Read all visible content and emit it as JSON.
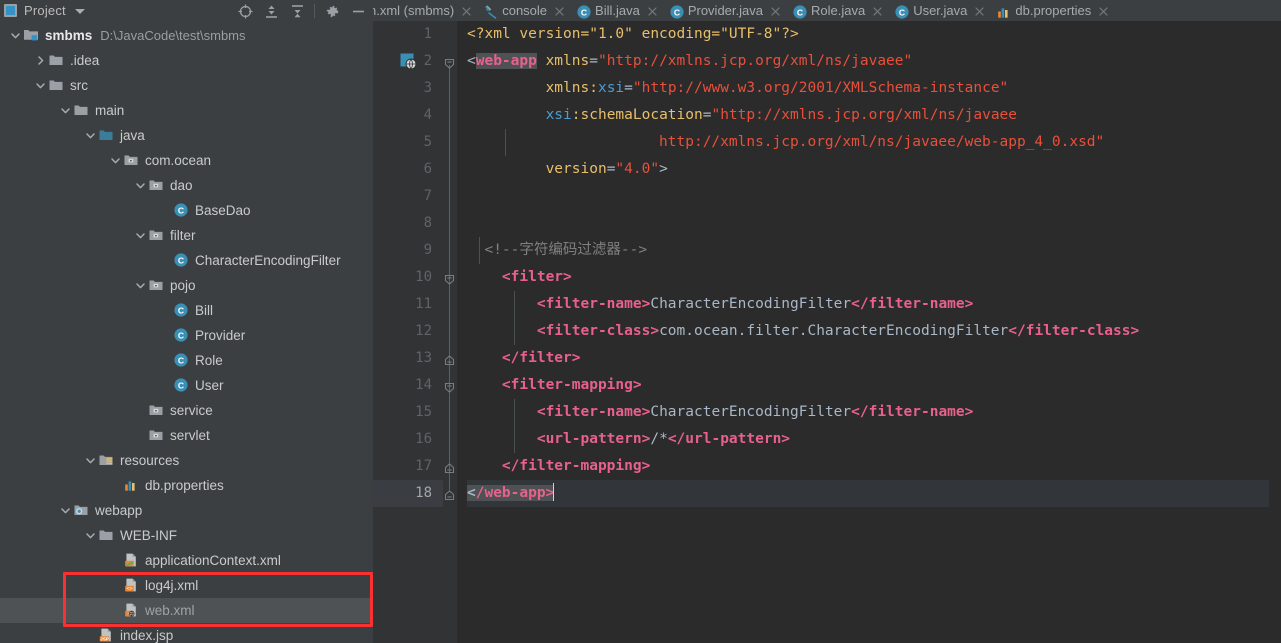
{
  "project_panel": {
    "title": "Project",
    "toolbar_icons": [
      {
        "name": "locate-icon",
        "glyph": "target"
      },
      {
        "name": "expand-all-icon",
        "glyph": "expand"
      },
      {
        "name": "collapse-all-icon",
        "glyph": "collapse"
      },
      {
        "name": "settings-gear-icon",
        "glyph": "gear"
      },
      {
        "name": "hide-panel-icon",
        "glyph": "minus"
      }
    ],
    "root": {
      "name": "smbms",
      "path": "D:\\JavaCode\\test\\smbms"
    },
    "tree": [
      {
        "label": "smbms",
        "detail": "D:\\JavaCode\\test\\smbms",
        "depth": 0,
        "icon": "module-folder",
        "arrow": "down",
        "bold": true,
        "selected": false
      },
      {
        "label": ".idea",
        "detail": "",
        "depth": 1,
        "icon": "folder",
        "arrow": "right",
        "bold": false,
        "selected": false
      },
      {
        "label": "src",
        "detail": "",
        "depth": 1,
        "icon": "folder",
        "arrow": "down",
        "bold": false,
        "selected": false
      },
      {
        "label": "main",
        "detail": "",
        "depth": 2,
        "icon": "folder",
        "arrow": "down",
        "bold": false,
        "selected": false
      },
      {
        "label": "java",
        "detail": "",
        "depth": 3,
        "icon": "source-folder",
        "arrow": "down",
        "bold": false,
        "selected": false
      },
      {
        "label": "com.ocean",
        "detail": "",
        "depth": 4,
        "icon": "package",
        "arrow": "down",
        "bold": false,
        "selected": false
      },
      {
        "label": "dao",
        "detail": "",
        "depth": 5,
        "icon": "package",
        "arrow": "down",
        "bold": false,
        "selected": false
      },
      {
        "label": "BaseDao",
        "detail": "",
        "depth": 6,
        "icon": "java-class",
        "arrow": "none",
        "bold": false,
        "selected": false
      },
      {
        "label": "filter",
        "detail": "",
        "depth": 5,
        "icon": "package",
        "arrow": "down",
        "bold": false,
        "selected": false
      },
      {
        "label": "CharacterEncodingFilter",
        "detail": "",
        "depth": 6,
        "icon": "java-class",
        "arrow": "none",
        "bold": false,
        "selected": false
      },
      {
        "label": "pojo",
        "detail": "",
        "depth": 5,
        "icon": "package",
        "arrow": "down",
        "bold": false,
        "selected": false
      },
      {
        "label": "Bill",
        "detail": "",
        "depth": 6,
        "icon": "java-class",
        "arrow": "none",
        "bold": false,
        "selected": false
      },
      {
        "label": "Provider",
        "detail": "",
        "depth": 6,
        "icon": "java-class",
        "arrow": "none",
        "bold": false,
        "selected": false
      },
      {
        "label": "Role",
        "detail": "",
        "depth": 6,
        "icon": "java-class",
        "arrow": "none",
        "bold": false,
        "selected": false
      },
      {
        "label": "User",
        "detail": "",
        "depth": 6,
        "icon": "java-class",
        "arrow": "none",
        "bold": false,
        "selected": false
      },
      {
        "label": "service",
        "detail": "",
        "depth": 5,
        "icon": "package",
        "arrow": "none",
        "bold": false,
        "selected": false
      },
      {
        "label": "servlet",
        "detail": "",
        "depth": 5,
        "icon": "package",
        "arrow": "none",
        "bold": false,
        "selected": false
      },
      {
        "label": "resources",
        "detail": "",
        "depth": 3,
        "icon": "resource-folder",
        "arrow": "down",
        "bold": false,
        "selected": false
      },
      {
        "label": "db.properties",
        "detail": "",
        "depth": 4,
        "icon": "properties-file",
        "arrow": "none",
        "bold": false,
        "selected": false
      },
      {
        "label": "webapp",
        "detail": "",
        "depth": 2,
        "icon": "web-folder",
        "arrow": "down",
        "bold": false,
        "selected": false
      },
      {
        "label": "WEB-INF",
        "detail": "",
        "depth": 3,
        "icon": "folder",
        "arrow": "down",
        "bold": false,
        "selected": false
      },
      {
        "label": "applicationContext.xml",
        "detail": "",
        "depth": 4,
        "icon": "spring-xml-file",
        "arrow": "none",
        "bold": false,
        "selected": false
      },
      {
        "label": "log4j.xml",
        "detail": "",
        "depth": 4,
        "icon": "xml-file",
        "arrow": "none",
        "bold": false,
        "selected": false
      },
      {
        "label": "web.xml",
        "detail": "",
        "depth": 4,
        "icon": "web-xml-file",
        "arrow": "none",
        "bold": false,
        "selected": true
      },
      {
        "label": "index.jsp",
        "detail": "",
        "depth": 3,
        "icon": "jsp-file",
        "arrow": "none",
        "bold": false,
        "selected": false
      }
    ],
    "annotation": {
      "color": "#f93131",
      "covers": [
        "log4j.xml",
        "web.xml"
      ]
    }
  },
  "editor": {
    "tabs": [
      {
        "label": "n.xml (smbms)",
        "icon": "xml-file",
        "active": false,
        "truncated": true,
        "closable": true
      },
      {
        "label": "console",
        "icon": "console-icon",
        "active": false,
        "truncated": false,
        "closable": true
      },
      {
        "label": "Bill.java",
        "icon": "java-class",
        "active": false,
        "truncated": false,
        "closable": true
      },
      {
        "label": "Provider.java",
        "icon": "java-class",
        "active": false,
        "truncated": false,
        "closable": true
      },
      {
        "label": "Role.java",
        "icon": "java-class",
        "active": false,
        "truncated": false,
        "closable": true
      },
      {
        "label": "User.java",
        "icon": "java-class",
        "active": false,
        "truncated": false,
        "closable": true
      },
      {
        "label": "db.properties",
        "icon": "properties-file",
        "active": false,
        "truncated": false,
        "closable": true
      }
    ],
    "filename": "web.xml",
    "current_line": 18,
    "total_lines": 18,
    "line_numbers": [
      "1",
      "2",
      "3",
      "4",
      "5",
      "6",
      "7",
      "8",
      "9",
      "10",
      "11",
      "12",
      "13",
      "14",
      "15",
      "16",
      "17",
      "18"
    ],
    "code_lines": [
      {
        "n": 1,
        "tokens": [
          {
            "t": "<?xml version=\"1.0\" encoding=\"UTF-8\"?>",
            "c": "proc"
          }
        ],
        "indent": 0
      },
      {
        "n": 2,
        "tokens": [
          {
            "t": "<",
            "c": "punct"
          },
          {
            "t": "web-app",
            "c": "tag-sel"
          },
          {
            "t": " ",
            "c": "text"
          },
          {
            "t": "xmlns",
            "c": "attrn"
          },
          {
            "t": "=",
            "c": "punct"
          },
          {
            "t": "\"http://xmlns.jcp.org/xml/ns/javaee\"",
            "c": "str"
          }
        ],
        "indent": 0
      },
      {
        "n": 3,
        "tokens": [
          {
            "t": "         ",
            "c": "text"
          },
          {
            "t": "xmlns:xsi",
            "c": "attrn-ns"
          },
          {
            "t": "=",
            "c": "punct"
          },
          {
            "t": "\"http://www.w3.org/2001/XMLSchema-instance\"",
            "c": "str"
          }
        ],
        "indent": 0
      },
      {
        "n": 4,
        "tokens": [
          {
            "t": "         ",
            "c": "text"
          },
          {
            "t": "xsi:schemaLocation",
            "c": "ns-attrn"
          },
          {
            "t": "=",
            "c": "punct"
          },
          {
            "t": "\"http://xmlns.jcp.org/xml/ns/javaee",
            "c": "str"
          }
        ],
        "indent": 0
      },
      {
        "n": 5,
        "tokens": [
          {
            "t": "                      http://xmlns.jcp.org/xml/ns/javaee/web-app_4_0.xsd\"",
            "c": "str"
          }
        ],
        "indent": 0
      },
      {
        "n": 6,
        "tokens": [
          {
            "t": "         ",
            "c": "text"
          },
          {
            "t": "version",
            "c": "attrn"
          },
          {
            "t": "=",
            "c": "punct"
          },
          {
            "t": "\"4.0\"",
            "c": "str"
          },
          {
            "t": ">",
            "c": "punct"
          }
        ],
        "indent": 0
      },
      {
        "n": 7,
        "tokens": [],
        "indent": 0
      },
      {
        "n": 8,
        "tokens": [],
        "indent": 0
      },
      {
        "n": 9,
        "tokens": [
          {
            "t": "  ",
            "c": "text"
          },
          {
            "t": "<!--字符编码过滤器-->",
            "c": "comment"
          }
        ],
        "indent": 0
      },
      {
        "n": 10,
        "tokens": [
          {
            "t": "    ",
            "c": "text"
          },
          {
            "t": "<filter>",
            "c": "tag"
          }
        ],
        "indent": 0
      },
      {
        "n": 11,
        "tokens": [
          {
            "t": "        ",
            "c": "text"
          },
          {
            "t": "<filter-name>",
            "c": "tag"
          },
          {
            "t": "CharacterEncodingFilter",
            "c": "text"
          },
          {
            "t": "</filter-name>",
            "c": "tag"
          }
        ],
        "indent": 0
      },
      {
        "n": 12,
        "tokens": [
          {
            "t": "        ",
            "c": "text"
          },
          {
            "t": "<filter-class>",
            "c": "tag"
          },
          {
            "t": "com.ocean.filter.CharacterEncodingFilter",
            "c": "text"
          },
          {
            "t": "</filter-class>",
            "c": "tag"
          }
        ],
        "indent": 0
      },
      {
        "n": 13,
        "tokens": [
          {
            "t": "    ",
            "c": "text"
          },
          {
            "t": "</filter>",
            "c": "tag"
          }
        ],
        "indent": 0
      },
      {
        "n": 14,
        "tokens": [
          {
            "t": "    ",
            "c": "text"
          },
          {
            "t": "<filter-mapping>",
            "c": "tag"
          }
        ],
        "indent": 0
      },
      {
        "n": 15,
        "tokens": [
          {
            "t": "        ",
            "c": "text"
          },
          {
            "t": "<filter-name>",
            "c": "tag"
          },
          {
            "t": "CharacterEncodingFilter",
            "c": "text"
          },
          {
            "t": "</filter-name>",
            "c": "tag"
          }
        ],
        "indent": 0
      },
      {
        "n": 16,
        "tokens": [
          {
            "t": "        ",
            "c": "text"
          },
          {
            "t": "<url-pattern>",
            "c": "tag"
          },
          {
            "t": "/*",
            "c": "text"
          },
          {
            "t": "</url-pattern>",
            "c": "tag"
          }
        ],
        "indent": 0
      },
      {
        "n": 17,
        "tokens": [
          {
            "t": "    ",
            "c": "text"
          },
          {
            "t": "</filter-mapping>",
            "c": "tag"
          }
        ],
        "indent": 0
      },
      {
        "n": 18,
        "tokens": [
          {
            "t": "</web-app>",
            "c": "tag-sel"
          },
          {
            "t": "",
            "c": "caret"
          }
        ],
        "indent": 0
      }
    ],
    "colors": {
      "background": "#2b2b2b",
      "gutter": "#313335",
      "tag": "#e8618c",
      "attribute": "#e8bf6a",
      "string": "#e8503b",
      "namespace": "#499dd3",
      "comment": "#808080",
      "text": "#a9b7c6",
      "current_line": "#323539",
      "selection": "#4f5254"
    }
  }
}
